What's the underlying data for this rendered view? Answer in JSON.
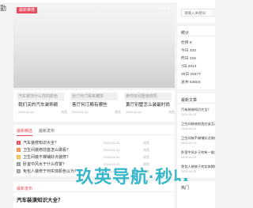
{
  "header": {
    "logo_text": "勤"
  },
  "slider": {
    "badge": "最新推荐"
  },
  "cards": [
    {
      "thumb_text": "汽车装饰什么样的颜色",
      "title": "我们买的汽车装饰颜",
      "date": "2024-01-01",
      "views": "浏览"
    },
    {
      "thumb_text": "张汀何汀殿来雕饼",
      "title": "客厅何汀殿有哪些",
      "date": "2024-01-01",
      "views": "浏览"
    },
    {
      "thumb_text": "黄你有别墅装修机",
      "title": "黄厅别墅怎么装最时尚",
      "date": "2024-01-01",
      "views": "浏览"
    }
  ],
  "list": {
    "tabs": [
      "最新精选",
      "最新发布"
    ],
    "rows": [
      {
        "rank": "1",
        "title": "汽车装修知识大全？",
        "date": "2024-01-01",
        "views": "浏览"
      },
      {
        "rank": "2",
        "title": "卫生间装修前首怎么做看？",
        "date": "2024-01-01",
        "views": "浏览"
      },
      {
        "rank": "3",
        "title": "卫生间装不梯铺好点装修？",
        "date": "2024-01-01",
        "views": "浏览"
      },
      {
        "rank": "4",
        "title": "卧室中风水于什么样置？",
        "date": "2024-01-01",
        "views": "浏览"
      },
      {
        "rank": "5",
        "title": "免包人装修于何实体颜色以为？",
        "date": "2024-01-01",
        "views": "浏览"
      }
    ]
  },
  "latest": {
    "head": "最新发布",
    "title": "汽车装潢知识大全？"
  },
  "watermark": "玖英导航·秒收",
  "sidebar": {
    "search_placeholder": "请输入关键词",
    "stats_head": "统计",
    "stats": [
      "栏目 8",
      "今日 333",
      "昨日 315",
      "7日 2014",
      "30日 18477",
      "总共 53604"
    ],
    "recent_head": "最新文章",
    "recent": [
      {
        "title": "汽车装修知识大全？",
        "date": "2024-01-01"
      },
      {
        "title": "卫生间装修前首应该怎么做看",
        "date": "2024-01-01"
      },
      {
        "title": "卫生间装不梯铺好点装修？",
        "date": "2024-01-01"
      },
      {
        "title": "卧室中风水于何有一般多变",
        "date": "2024-01-01"
      },
      {
        "title": "免包人装修于何实体颜色以为",
        "date": "2024-01-01"
      }
    ],
    "bottom_head": "热门"
  },
  "colors": {
    "accent": "#e94b5a",
    "watermark": "#2bb3c9"
  }
}
